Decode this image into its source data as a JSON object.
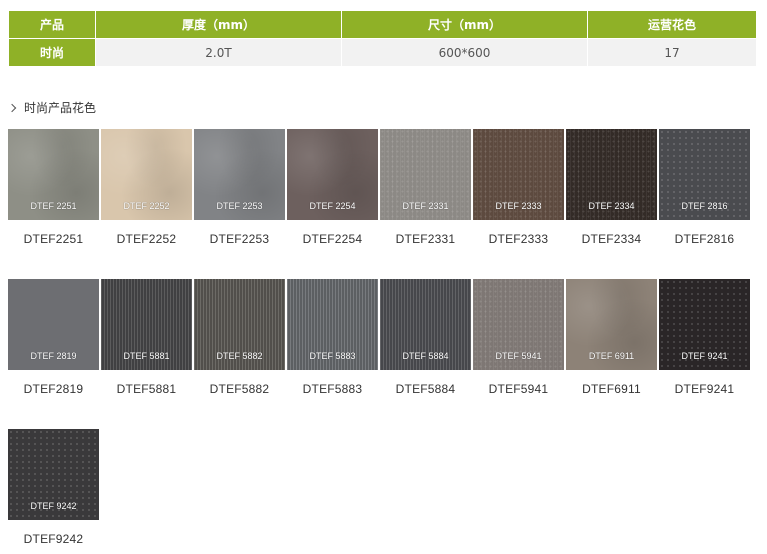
{
  "spec_table": {
    "headers": [
      "产品",
      "厚度（mm）",
      "尺寸（mm）",
      "运营花色"
    ],
    "row": {
      "product": "时尚",
      "thickness": "2.0T",
      "size": "600*600",
      "colors": "17"
    },
    "accent_color": "#8fb127"
  },
  "section": {
    "title": "时尚产品花色",
    "icon": "chevron-right-icon"
  },
  "swatches": [
    {
      "code": "DTEF 2251",
      "label": "DTEF2251",
      "color": "#8e8f86",
      "pattern": "mottled"
    },
    {
      "code": "DTEF 2252",
      "label": "DTEF2252",
      "color": "#d9c6ac",
      "pattern": "mottled"
    },
    {
      "code": "DTEF 2253",
      "label": "DTEF2253",
      "color": "#818386",
      "pattern": "mottled"
    },
    {
      "code": "DTEF 2254",
      "label": "DTEF2254",
      "color": "#6d605e",
      "pattern": "mottled"
    },
    {
      "code": "DTEF 2331",
      "label": "DTEF2331",
      "color": "#8c8985",
      "pattern": "speckle"
    },
    {
      "code": "DTEF 2333",
      "label": "DTEF2333",
      "color": "#5d4a3f",
      "pattern": "speckle"
    },
    {
      "code": "DTEF 2334",
      "label": "DTEF2334",
      "color": "#332b27",
      "pattern": "speckle"
    },
    {
      "code": "DTEF 2816",
      "label": "DTEF2816",
      "color": "#4a4b4f",
      "pattern": "dots"
    },
    {
      "code": "DTEF 2819",
      "label": "DTEF2819",
      "color": "#6d6e72",
      "pattern": "plain"
    },
    {
      "code": "DTEF 5881",
      "label": "DTEF5881",
      "color": "#49494b",
      "pattern": "stripes"
    },
    {
      "code": "DTEF 5882",
      "label": "DTEF5882",
      "color": "#5c5a55",
      "pattern": "stripes"
    },
    {
      "code": "DTEF 5883",
      "label": "DTEF5883",
      "color": "#696c70",
      "pattern": "stripes"
    },
    {
      "code": "DTEF 5884",
      "label": "DTEF5884",
      "color": "#505155",
      "pattern": "stripes"
    },
    {
      "code": "DTEF 5941",
      "label": "DTEF5941",
      "color": "#7e7774",
      "pattern": "speckle"
    },
    {
      "code": "DTEF 6911",
      "label": "DTEF6911",
      "color": "#8d8277",
      "pattern": "mottled"
    },
    {
      "code": "DTEF 9241",
      "label": "DTEF9241",
      "color": "#2a2627",
      "pattern": "dots"
    },
    {
      "code": "DTEF 9242",
      "label": "DTEF9242",
      "color": "#3a393b",
      "pattern": "dots"
    }
  ]
}
